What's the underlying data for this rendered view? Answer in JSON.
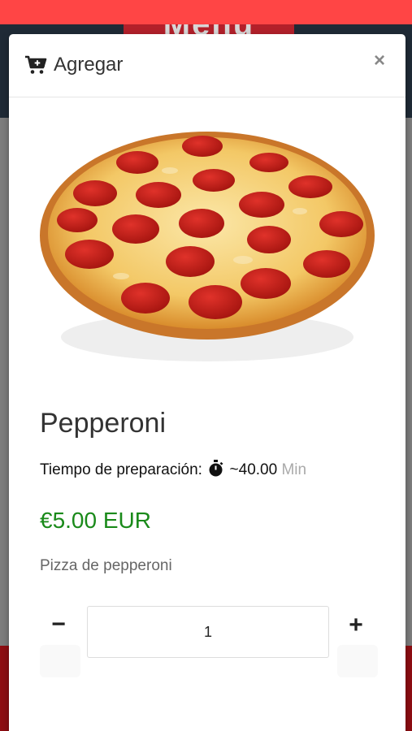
{
  "background": {
    "banner_text": "Menu"
  },
  "modal": {
    "title": "Agregar",
    "close_symbol": "×",
    "header_icon": "cart-plus-icon"
  },
  "product": {
    "image_alt": "pizza-pepperoni-image",
    "name": "Pepperoni",
    "prep_label": "Tiempo de preparación:",
    "prep_icon": "stopwatch-icon",
    "prep_time": "~40.00",
    "prep_unit": "Min",
    "price": "€5.00 EUR",
    "description": "Pizza de pepperoni"
  },
  "quantity": {
    "minus_label": "−",
    "value": "1",
    "plus_label": "+"
  },
  "colors": {
    "price": "#1a8a1a",
    "accent_red": "#ff4545",
    "header_dark": "#1f2a36"
  }
}
